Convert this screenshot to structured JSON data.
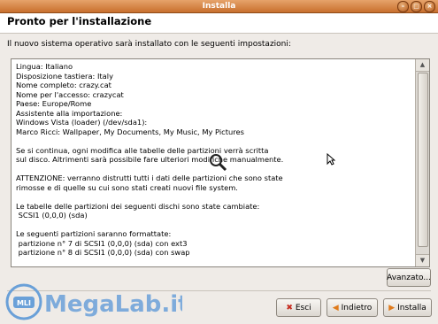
{
  "window": {
    "title": "Installa",
    "controls": [
      "minimize",
      "maximize",
      "close"
    ]
  },
  "header": {
    "title": "Pronto per l'installazione"
  },
  "subtitle": "Il nuovo sistema operativo sarà installato con le seguenti impostazioni:",
  "summary_text": "Lingua: Italiano\nDisposizione tastiera: Italy\nNome completo: crazy.cat\nNome per l'accesso: crazycat\nPaese: Europe/Rome\nAssistente alla importazione:\nWindows Vista (loader) (/dev/sda1):\nMarco Ricci: Wallpaper, My Documents, My Music, My Pictures\n\nSe si continua, ogni modifica alle tabelle delle partizioni verrà scritta\nsul disco. Altrimenti sarà possibile fare ulteriori modifiche manualmente.\n\nATTENZIONE: verranno distrutti tutti i dati delle partizioni che sono state\nrimosse e di quelle su cui sono stati creati nuovi file system.\n\nLe tabelle delle partizioni dei seguenti dischi sono state cambiate:\n SCSI1 (0,0,0) (sda)\n\nLe seguenti partizioni saranno formattate:\n partizione n° 7 di SCSI1 (0,0,0) (sda) con ext3\n partizione n° 8 di SCSI1 (0,0,0) (sda) con swap",
  "buttons": {
    "advanced": "Avanzato...",
    "quit": "Esci",
    "back": "Indietro",
    "install": "Installa"
  },
  "watermark": {
    "text": "MegaLab.it",
    "badge": "MLI"
  },
  "colors": {
    "titlebar": "#c86f2d",
    "background": "#efebe7",
    "watermark": "#6aa0d8"
  }
}
